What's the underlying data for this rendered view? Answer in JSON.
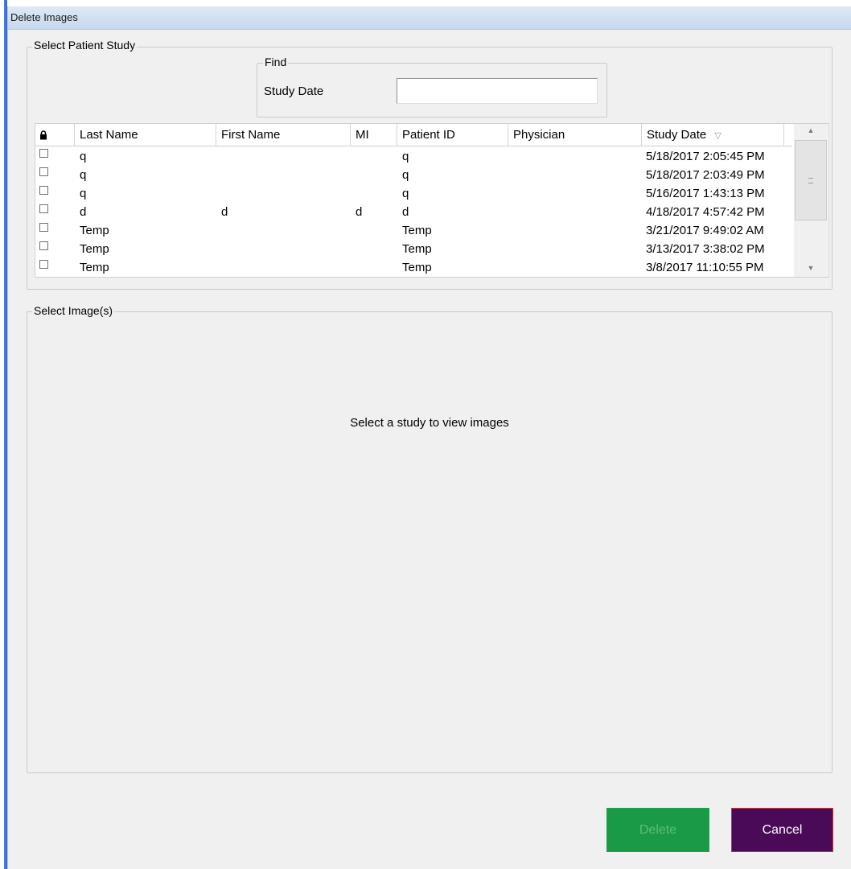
{
  "window": {
    "title": "Delete Images"
  },
  "patient_study": {
    "label": "Select Patient Study",
    "find": {
      "label": "Find",
      "study_date_label": "Study Date",
      "study_date_value": "",
      "study_date_placeholder": ""
    },
    "columns": [
      "Last Name",
      "First Name",
      "MI",
      "Patient ID",
      "Physician",
      "Study Date"
    ],
    "sort_indicator": "▽",
    "rows": [
      {
        "last": "q",
        "first": "",
        "mi": "",
        "pid": "q",
        "physician": "",
        "date": "5/18/2017 2:05:45 PM"
      },
      {
        "last": "q",
        "first": "",
        "mi": "",
        "pid": "q",
        "physician": "",
        "date": "5/18/2017 2:03:49 PM"
      },
      {
        "last": "q",
        "first": "",
        "mi": "",
        "pid": "q",
        "physician": "",
        "date": "5/16/2017 1:43:13 PM"
      },
      {
        "last": "d",
        "first": "d",
        "mi": "d",
        "pid": "d",
        "physician": "",
        "date": "4/18/2017 4:57:42 PM"
      },
      {
        "last": "Temp",
        "first": "",
        "mi": "",
        "pid": "Temp",
        "physician": "",
        "date": "3/21/2017 9:49:02 AM"
      },
      {
        "last": "Temp",
        "first": "",
        "mi": "",
        "pid": "Temp",
        "physician": "",
        "date": "3/13/2017 3:38:02 PM"
      },
      {
        "last": "Temp",
        "first": "",
        "mi": "",
        "pid": "Temp",
        "physician": "",
        "date": "3/8/2017 11:10:55 PM"
      }
    ]
  },
  "images": {
    "label": "Select Image(s)",
    "placeholder": "Select a study to view images"
  },
  "buttons": {
    "delete": "Delete",
    "cancel": "Cancel"
  },
  "colors": {
    "delete_bg": "#1a9a46",
    "cancel_bg": "#4a0a58",
    "title_bar": "#c7d9ee"
  },
  "icons": {
    "lock_column": "lock-icon",
    "row_select": "checkbox-icon"
  }
}
